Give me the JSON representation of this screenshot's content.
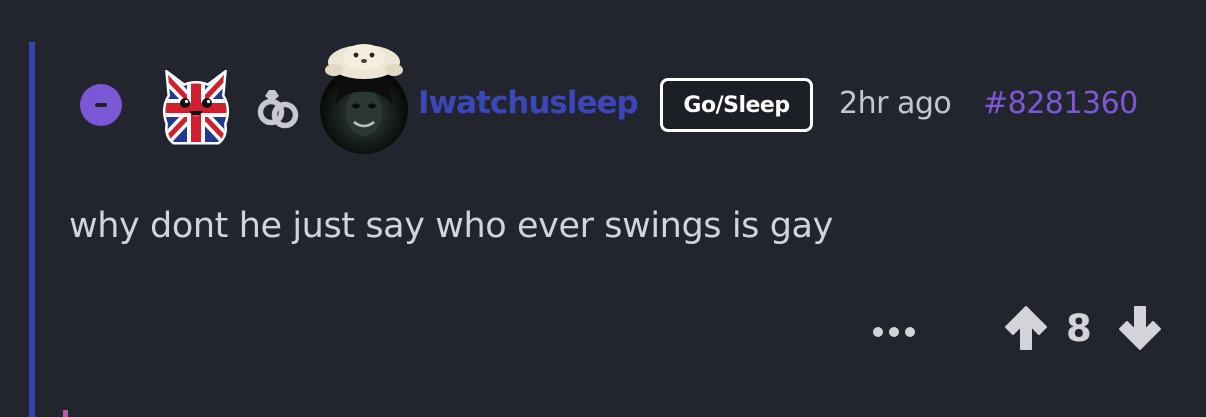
{
  "comment": {
    "username": "Iwatchusleep",
    "flair": "Go/Sleep",
    "time": "2hr ago",
    "id": "#8281360",
    "body": "why dont he just say who ever swings is gay",
    "score": "8"
  },
  "icons": {
    "collapse": "minus-circle-icon",
    "badge": "union-jack-cat-icon",
    "rings": "wedding-rings-icon",
    "avatar": "user-avatar-with-seal-hat",
    "more": "ellipsis-icon",
    "up": "arrow-up-icon",
    "down": "arrow-down-icon"
  },
  "colors": {
    "background": "#22252d",
    "thread_line": "#3b42a8",
    "username": "#3b47b8",
    "comment_id": "#7d58d2",
    "collapse_button": "#7b57d6",
    "text": "#d2d4d9"
  }
}
